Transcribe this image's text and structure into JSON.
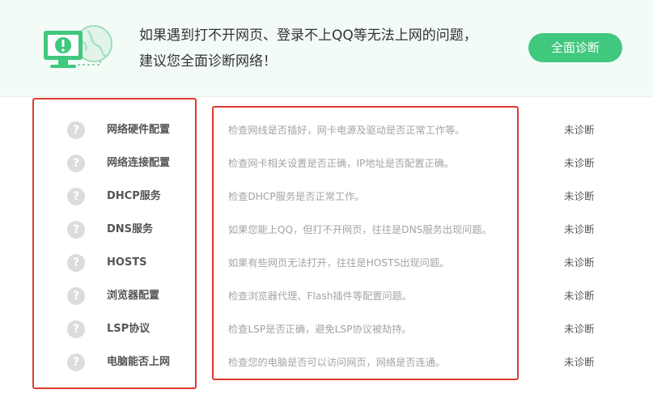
{
  "banner": {
    "line1": "如果遇到打不开网页、登录不上QQ等无法上网的问题，",
    "line2": "建议您全面诊断网络！",
    "diagnose_button": "全面诊断",
    "illustration_icon": "monitor-alert-globe-icon"
  },
  "colors": {
    "accent_green": "#3fc87e",
    "highlight_red": "#e03a2f",
    "banner_bg": "#f3fbf7"
  },
  "checks": [
    {
      "icon": "question-icon",
      "name": "网络硬件配置",
      "desc": "检查网线是否插好，网卡电源及驱动是否正常工作等。",
      "status": "未诊断"
    },
    {
      "icon": "question-icon",
      "name": "网络连接配置",
      "desc": "检查网卡相关设置是否正确，IP地址是否配置正确。",
      "status": "未诊断"
    },
    {
      "icon": "question-icon",
      "name": "DHCP服务",
      "desc": "检查DHCP服务是否正常工作。",
      "status": "未诊断"
    },
    {
      "icon": "question-icon",
      "name": "DNS服务",
      "desc": "如果您能上QQ，但打不开网页，往往是DNS服务出现问题。",
      "status": "未诊断"
    },
    {
      "icon": "question-icon",
      "name": "HOSTS",
      "desc": "如果有些网页无法打开，往往是HOSTS出现问题。",
      "status": "未诊断"
    },
    {
      "icon": "question-icon",
      "name": "浏览器配置",
      "desc": "检查浏览器代理、Flash插件等配置问题。",
      "status": "未诊断"
    },
    {
      "icon": "question-icon",
      "name": "LSP协议",
      "desc": "检查LSP是否正确，避免LSP协议被劫持。",
      "status": "未诊断"
    },
    {
      "icon": "question-icon",
      "name": "电脑能否上网",
      "desc": "检查您的电脑是否可以访问网页，网络是否连通。",
      "status": "未诊断"
    }
  ]
}
